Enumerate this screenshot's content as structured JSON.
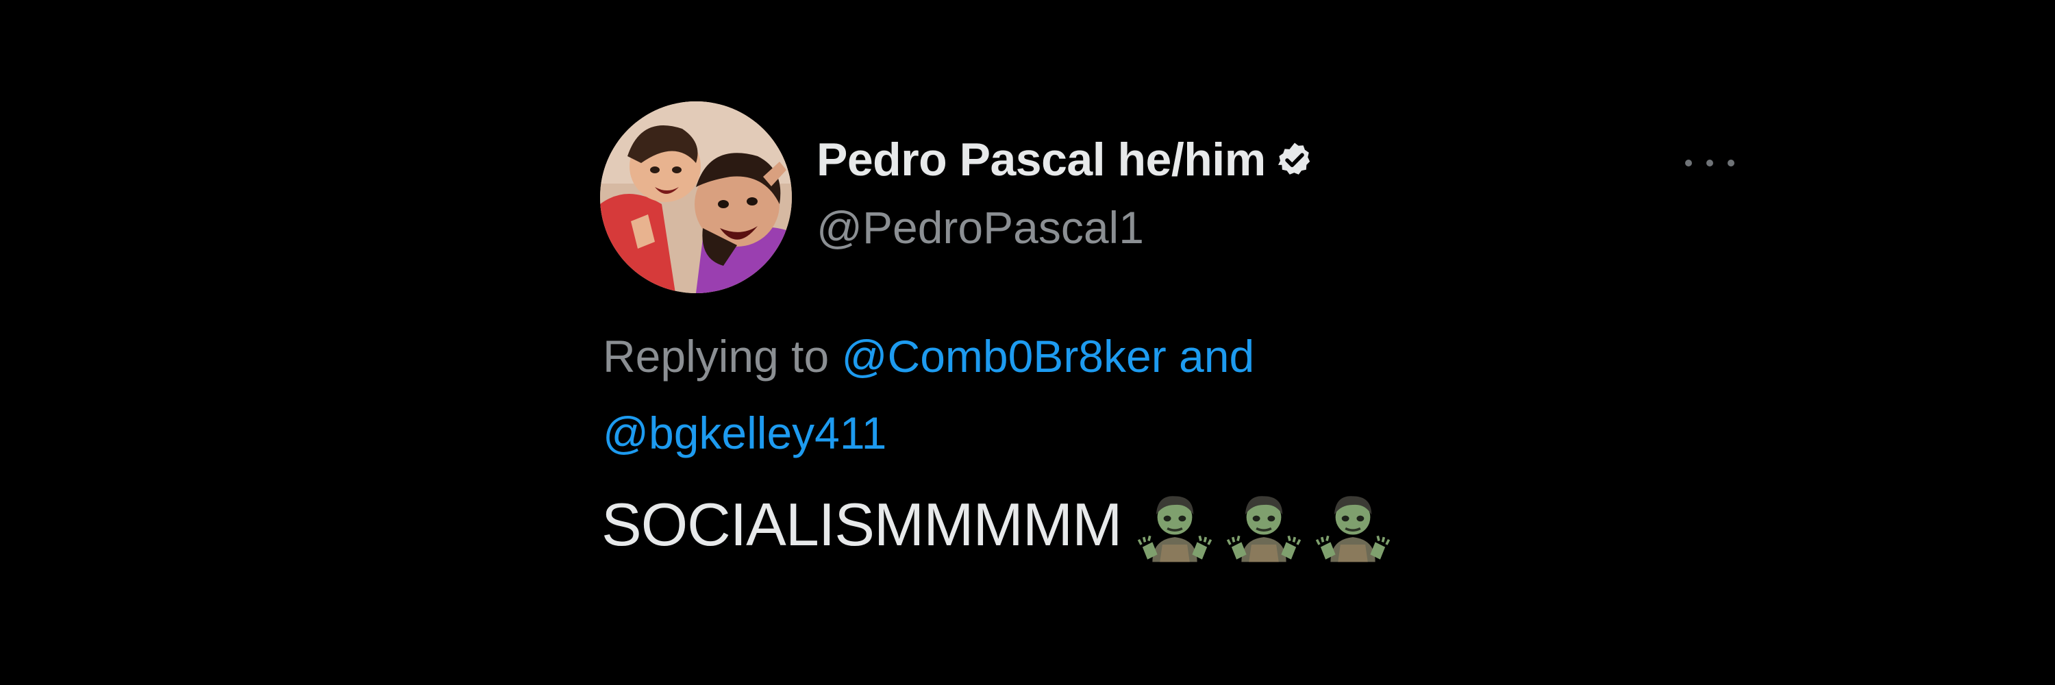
{
  "tweet": {
    "author": {
      "display_name": "Pedro Pascal he/him",
      "handle": "@PedroPascal1",
      "verified": true,
      "avatar": "profile-photo"
    },
    "reply_context": {
      "prefix": "Replying to",
      "mention_1": "@Comb0Br8ker",
      "joiner": "and",
      "mention_2": "@bgkelley411"
    },
    "text": "SOCIALISMMMMM",
    "emoji": [
      "zombie-icon",
      "zombie-icon",
      "zombie-icon"
    ],
    "more_menu": "more-options-icon"
  },
  "colors": {
    "background": "#000000",
    "primary_text": "#e7e9ea",
    "secondary_text": "#8b8f93",
    "link": "#1d9bf0"
  }
}
